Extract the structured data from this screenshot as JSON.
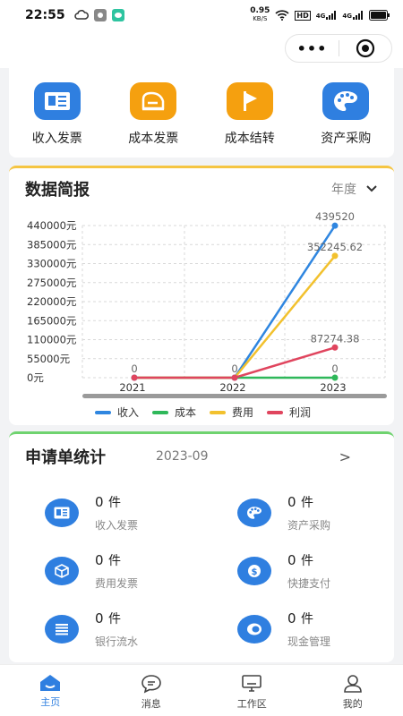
{
  "status": {
    "time": "22:55",
    "net_speed_value": "0.95",
    "net_speed_unit": "KB/S",
    "hd": "HD",
    "sig1": "4G",
    "sig2": "4G"
  },
  "capsule": {
    "more": "•••",
    "target_icon": "target-icon"
  },
  "quick_actions": [
    {
      "label": "收入发票",
      "icon": "income-invoice-icon",
      "color": "#2f7fe0"
    },
    {
      "label": "成本发票",
      "icon": "cost-invoice-icon",
      "color": "#f5a00f"
    },
    {
      "label": "成本结转",
      "icon": "flag-icon",
      "color": "#f5a00f"
    },
    {
      "label": "资产采购",
      "icon": "palette-icon",
      "color": "#2f7fe0"
    }
  ],
  "data_overview": {
    "title": "数据简报",
    "filter_label": "年度",
    "filter_icon": "chevron-down-icon"
  },
  "chart_data": {
    "type": "line",
    "x": [
      "2021",
      "2022",
      "2023"
    ],
    "ylim": [
      0,
      440000
    ],
    "y_ticks": [
      "0元",
      "55000元",
      "110000元",
      "165000元",
      "220000元",
      "275000元",
      "330000元",
      "385000元",
      "440000元"
    ],
    "series": [
      {
        "name": "收入",
        "color": "#2f86e0",
        "values": [
          0,
          0,
          439520
        ],
        "labels": [
          "0",
          "0",
          "439520"
        ]
      },
      {
        "name": "成本",
        "color": "#2fb85a",
        "values": [
          0,
          0,
          0
        ],
        "labels": [
          "",
          "",
          "0"
        ]
      },
      {
        "name": "费用",
        "color": "#f2c12e",
        "values": [
          0,
          0,
          352245.62
        ],
        "labels": [
          "",
          "",
          "352245.62"
        ]
      },
      {
        "name": "利润",
        "color": "#e0455e",
        "values": [
          0,
          0,
          87274.38
        ],
        "labels": [
          "",
          "",
          "87274.38"
        ]
      }
    ],
    "grid": true,
    "legend": "bottom"
  },
  "apply_stats": {
    "title": "申请单统计",
    "month": "2023-09",
    "arrow": ">",
    "items": [
      {
        "count": "0",
        "unit": "件",
        "label": "收入发票",
        "icon": "invoice-icon"
      },
      {
        "count": "0",
        "unit": "件",
        "label": "资产采购",
        "icon": "palette-icon"
      },
      {
        "count": "0",
        "unit": "件",
        "label": "费用发票",
        "icon": "box-icon"
      },
      {
        "count": "0",
        "unit": "件",
        "label": "快捷支付",
        "icon": "dollar-icon"
      },
      {
        "count": "0",
        "unit": "件",
        "label": "银行流水",
        "icon": "list-icon"
      },
      {
        "count": "0",
        "unit": "件",
        "label": "现金管理",
        "icon": "coin-icon"
      }
    ]
  },
  "tabbar": [
    {
      "label": "主页",
      "icon": "home-icon",
      "active": true,
      "color": "#2f7fe0"
    },
    {
      "label": "消息",
      "icon": "message-icon",
      "active": false
    },
    {
      "label": "工作区",
      "icon": "desktop-icon",
      "active": false
    },
    {
      "label": "我的",
      "icon": "user-icon",
      "active": false
    }
  ]
}
